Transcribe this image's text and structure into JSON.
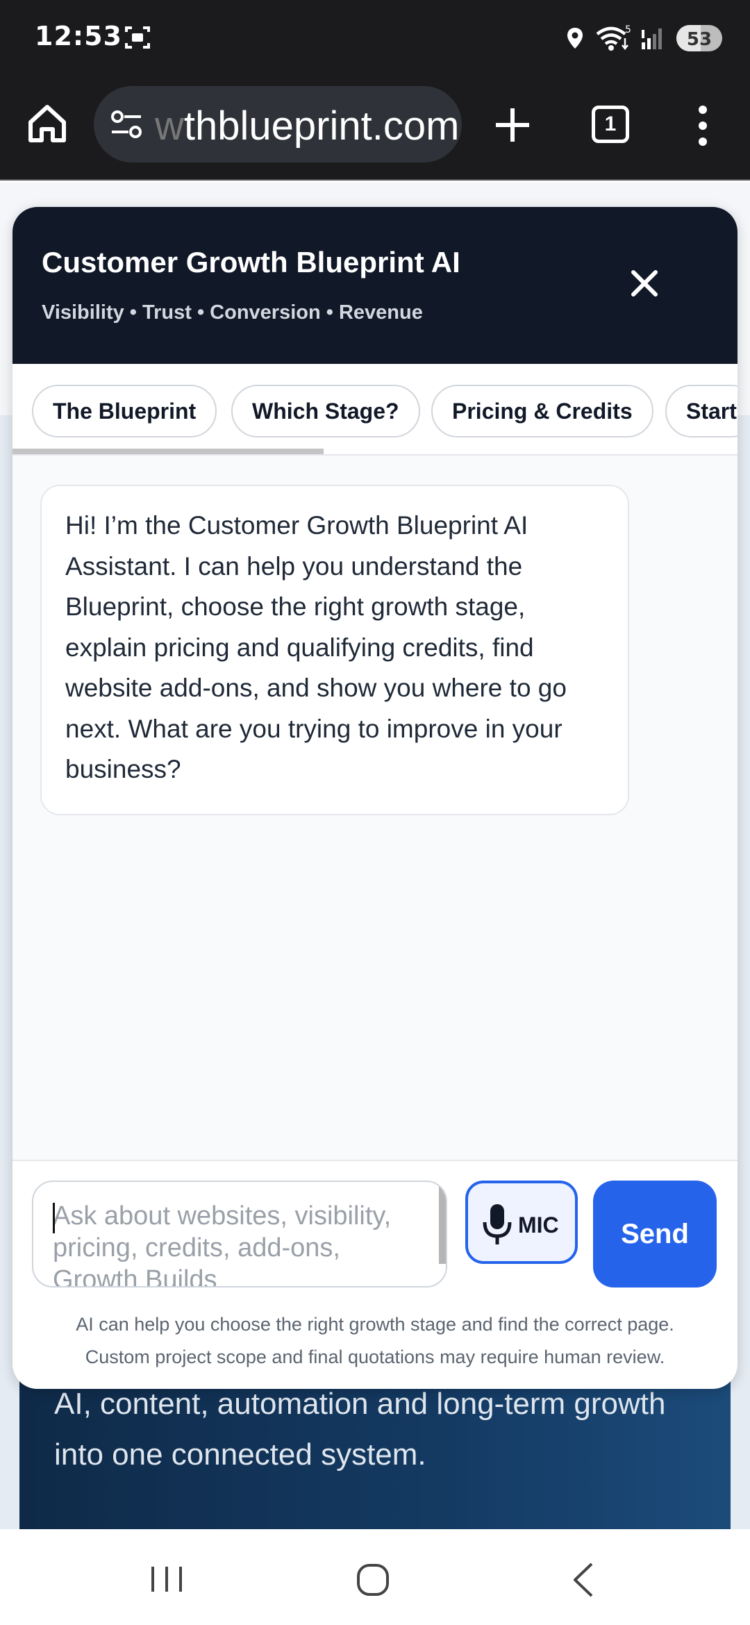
{
  "status_bar": {
    "time": "12:53",
    "icons": [
      "screenshot-icon",
      "location-icon",
      "wifi-icon",
      "signal-icon"
    ],
    "wifi_badge": "5",
    "battery_level": "53"
  },
  "browser": {
    "url_faded": "w",
    "url_visible": "thblueprint.com",
    "tab_count": "1",
    "icons": [
      "home-icon",
      "site-settings-icon",
      "plus-icon",
      "tabs-icon",
      "more-vert-icon"
    ]
  },
  "background_page": {
    "hero_text": "booking, payments, QR marketing, managed AI, content, automation and long-term growth into one connected system."
  },
  "widget": {
    "title": "Customer Growth Blueprint AI",
    "subtitle": "Visibility • Trust • Conversion • Revenue",
    "close_icon": "close-icon",
    "tabs": [
      {
        "label": "The Blueprint"
      },
      {
        "label": "Which Stage?"
      },
      {
        "label": "Pricing & Credits"
      },
      {
        "label": "Start"
      }
    ],
    "messages": [
      {
        "role": "assistant",
        "text": "Hi! I’m the Customer Growth Blueprint AI Assistant. I can help you understand the Blueprint, choose the right growth stage, explain pricing and qualifying credits, find website add-ons, and show you where to go next. What are you trying to improve in your business?"
      }
    ],
    "composer": {
      "placeholder": "Ask about websites, visibility, pricing, credits, add-ons, Growth Builds",
      "mic_label": "MIC",
      "send_label": "Send"
    },
    "disclaimer_line1": "AI can help you choose the right growth stage and find the correct page.",
    "disclaimer_line2": "Custom project scope and final quotations may require human review."
  },
  "nav_bar": {
    "icons": [
      "recent-apps-icon",
      "home-icon",
      "back-icon"
    ]
  },
  "colors": {
    "header_bg": "#111827",
    "accent_blue": "#2563eb",
    "browser_bg": "#1b1b1d"
  }
}
